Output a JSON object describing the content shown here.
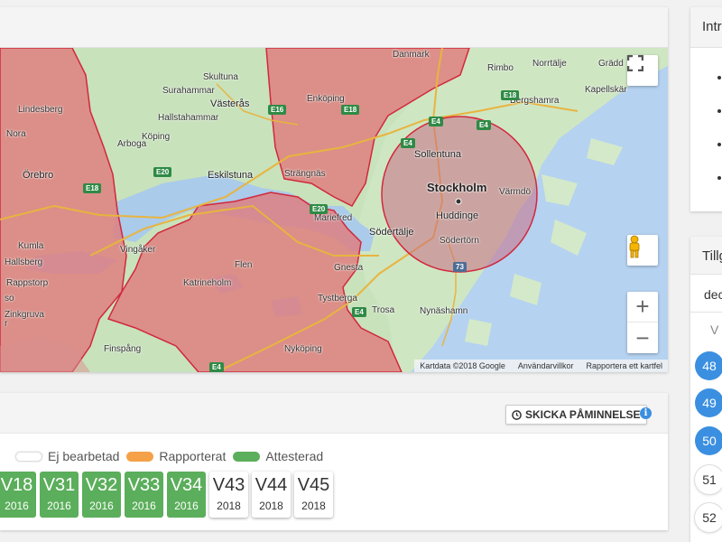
{
  "map": {
    "places": {
      "danmark": "Danmark",
      "norrtalje": "Norrtälje",
      "rimbo": "Rimbo",
      "gradd": "Grädd",
      "skultuna": "Skultuna",
      "surahammar": "Surahammar",
      "vasteras": "Västerås",
      "enkoping": "Enköping",
      "kapellskar": "Kapellskär",
      "bergshamra": "Bergshamra",
      "lindesberg": "Lindesberg",
      "hallstahammar": "Hallstahammar",
      "nora": "Nora",
      "koping": "Köping",
      "sollentuna": "Sollentuna",
      "arboga": "Arboga",
      "eskilstuna": "Eskilstuna",
      "strangnas": "Strängnäs",
      "orebro": "Örebro",
      "stockholm": "Stockholm",
      "varmdo": "Värmdö",
      "mariefred": "Mariefred",
      "sodertalje": "Södertälje",
      "huddinge": "Huddinge",
      "sodertorn": "Södertörn",
      "kumla": "Kumla",
      "hallsberg": "Hallsberg",
      "vingaker": "Vingåker",
      "flen": "Flen",
      "gnesta": "Gnesta",
      "rappstorp": "Rappstorp",
      "katrineholm": "Katrineholm",
      "trosa": "Trosa",
      "tystberga": "Tystberga",
      "nynashamn": "Nynäshamn",
      "zinkgruva": "Zinkgruva",
      "finspang": "Finspång",
      "nykoping": "Nyköping",
      "so": "so",
      "r": "r"
    },
    "roads": [
      "E18",
      "E4",
      "E20",
      "E18",
      "E16",
      "E4",
      "E18",
      "E20",
      "E4",
      "E4",
      "E4",
      "73"
    ],
    "attribution": {
      "data": "Kartdata ©2018 Google",
      "terms": "Användarvillkor",
      "report": "Rapportera ett kartfel"
    },
    "controls": {
      "fullscreen": "fullscreen-icon",
      "pegman": "pegman-icon",
      "zoom_in": "+",
      "zoom_out": "−"
    },
    "colors": {
      "water": "#b5d2f0",
      "land": "#c8e2bc",
      "region_fill": "#e07b7b",
      "region_border": "#d2283c",
      "circle_fill": "#c96e86"
    }
  },
  "report": {
    "reminder_label": "SKICKA PÅMINNELSE",
    "info": "i",
    "legend": [
      {
        "label": "Ej bearbetad",
        "color": "#ffffff"
      },
      {
        "label": "Rapporterat",
        "color": "#f4a148"
      },
      {
        "label": "Attesterad",
        "color": "#5bae5b"
      }
    ],
    "weeks": [
      {
        "week": "V18",
        "year": "2016",
        "status": "attesterad"
      },
      {
        "week": "V31",
        "year": "2016",
        "status": "attesterad"
      },
      {
        "week": "V32",
        "year": "2016",
        "status": "attesterad"
      },
      {
        "week": "V33",
        "year": "2016",
        "status": "attesterad"
      },
      {
        "week": "V34",
        "year": "2016",
        "status": "attesterad"
      },
      {
        "week": "V43",
        "year": "2018",
        "status": "ej-bearbetad"
      },
      {
        "week": "V44",
        "year": "2018",
        "status": "ej-bearbetad"
      },
      {
        "week": "V45",
        "year": "2018",
        "status": "ej-bearbetad"
      }
    ]
  },
  "intro": {
    "title": "Intr"
  },
  "availability": {
    "title": "Tillg",
    "subtitle": "dec",
    "column_label": "V",
    "weeks": [
      {
        "number": "48",
        "selected": true
      },
      {
        "number": "49",
        "selected": true
      },
      {
        "number": "50",
        "selected": true
      },
      {
        "number": "51",
        "selected": false
      },
      {
        "number": "52",
        "selected": false
      }
    ]
  }
}
